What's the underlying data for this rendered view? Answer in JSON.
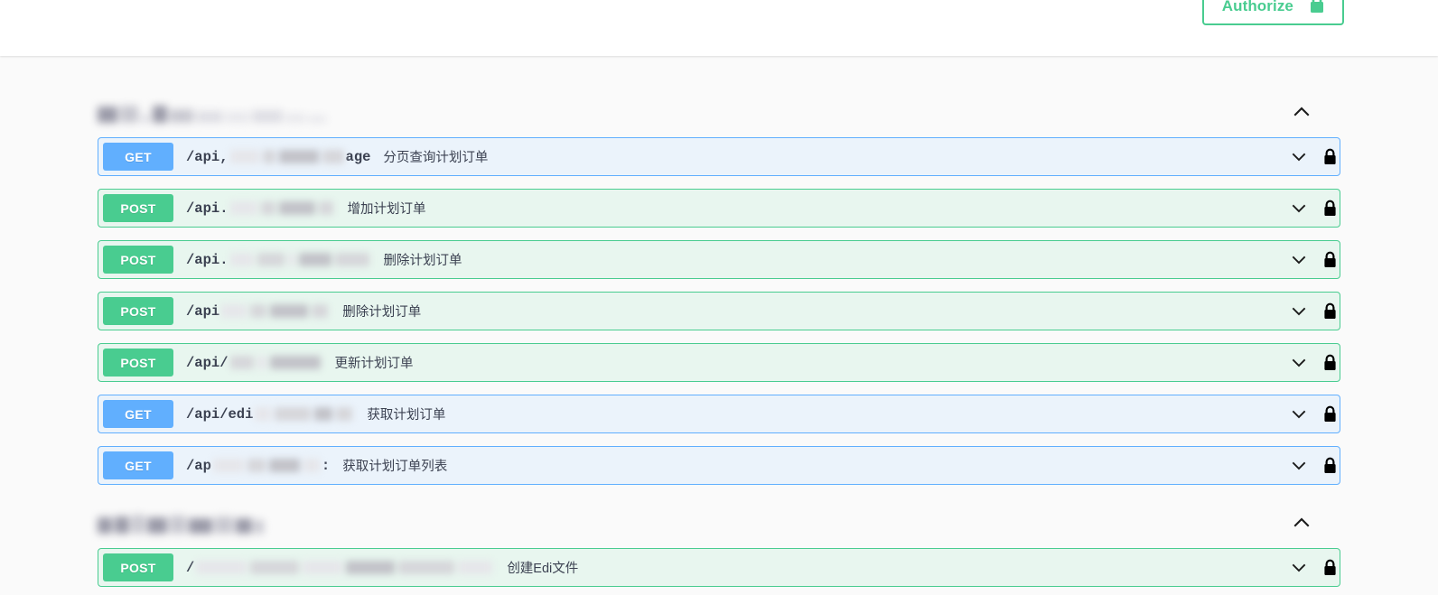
{
  "topbar": {
    "authorize_label": "Authorize",
    "authorize_icon": "lock-icon",
    "accent_color": "#49cc90"
  },
  "colors": {
    "get_badge": "#61affe",
    "get_row_bg": "#ebf3fb",
    "post_badge": "#49cc90",
    "post_row_bg": "#e8f6ef",
    "page_bg": "#fafafa",
    "text": "#3b4151"
  },
  "sections": [
    {
      "name": "",
      "redacted": true,
      "expanded": true,
      "toggle_icon": "chevron-up-icon",
      "operations": [
        {
          "method": "GET",
          "path_prefix": "/api,",
          "path_suffix": "age",
          "path_redacted": true,
          "summary": "分页查询计划订单",
          "expand_icon": "chevron-down-icon",
          "auth_icon": "lock-icon"
        },
        {
          "method": "POST",
          "path_prefix": "/api.",
          "path_suffix": "",
          "path_redacted": true,
          "summary": "增加计划订单",
          "expand_icon": "chevron-down-icon",
          "auth_icon": "lock-icon"
        },
        {
          "method": "POST",
          "path_prefix": "/api.",
          "path_suffix": "",
          "path_redacted": true,
          "summary": "删除计划订单",
          "expand_icon": "chevron-down-icon",
          "auth_icon": "lock-icon"
        },
        {
          "method": "POST",
          "path_prefix": "/api",
          "path_suffix": "",
          "path_redacted": true,
          "summary": "删除计划订单",
          "expand_icon": "chevron-down-icon",
          "auth_icon": "lock-icon"
        },
        {
          "method": "POST",
          "path_prefix": "/api/",
          "path_suffix": "",
          "path_redacted": true,
          "summary": "更新计划订单",
          "expand_icon": "chevron-down-icon",
          "auth_icon": "lock-icon"
        },
        {
          "method": "GET",
          "path_prefix": "/api/edi",
          "path_suffix": "",
          "path_redacted": true,
          "summary": "获取计划订单",
          "expand_icon": "chevron-down-icon",
          "auth_icon": "lock-icon"
        },
        {
          "method": "GET",
          "path_prefix": "/ap",
          "path_suffix": ":",
          "path_redacted": true,
          "summary": "获取计划订单列表",
          "expand_icon": "chevron-down-icon",
          "auth_icon": "lock-icon"
        }
      ]
    },
    {
      "name": "",
      "redacted": true,
      "expanded": true,
      "toggle_icon": "chevron-up-icon",
      "operations": [
        {
          "method": "POST",
          "path_prefix": "/",
          "path_suffix": "",
          "path_redacted": true,
          "summary": "创建Edi文件",
          "expand_icon": "chevron-down-icon",
          "auth_icon": "lock-icon"
        }
      ]
    }
  ]
}
